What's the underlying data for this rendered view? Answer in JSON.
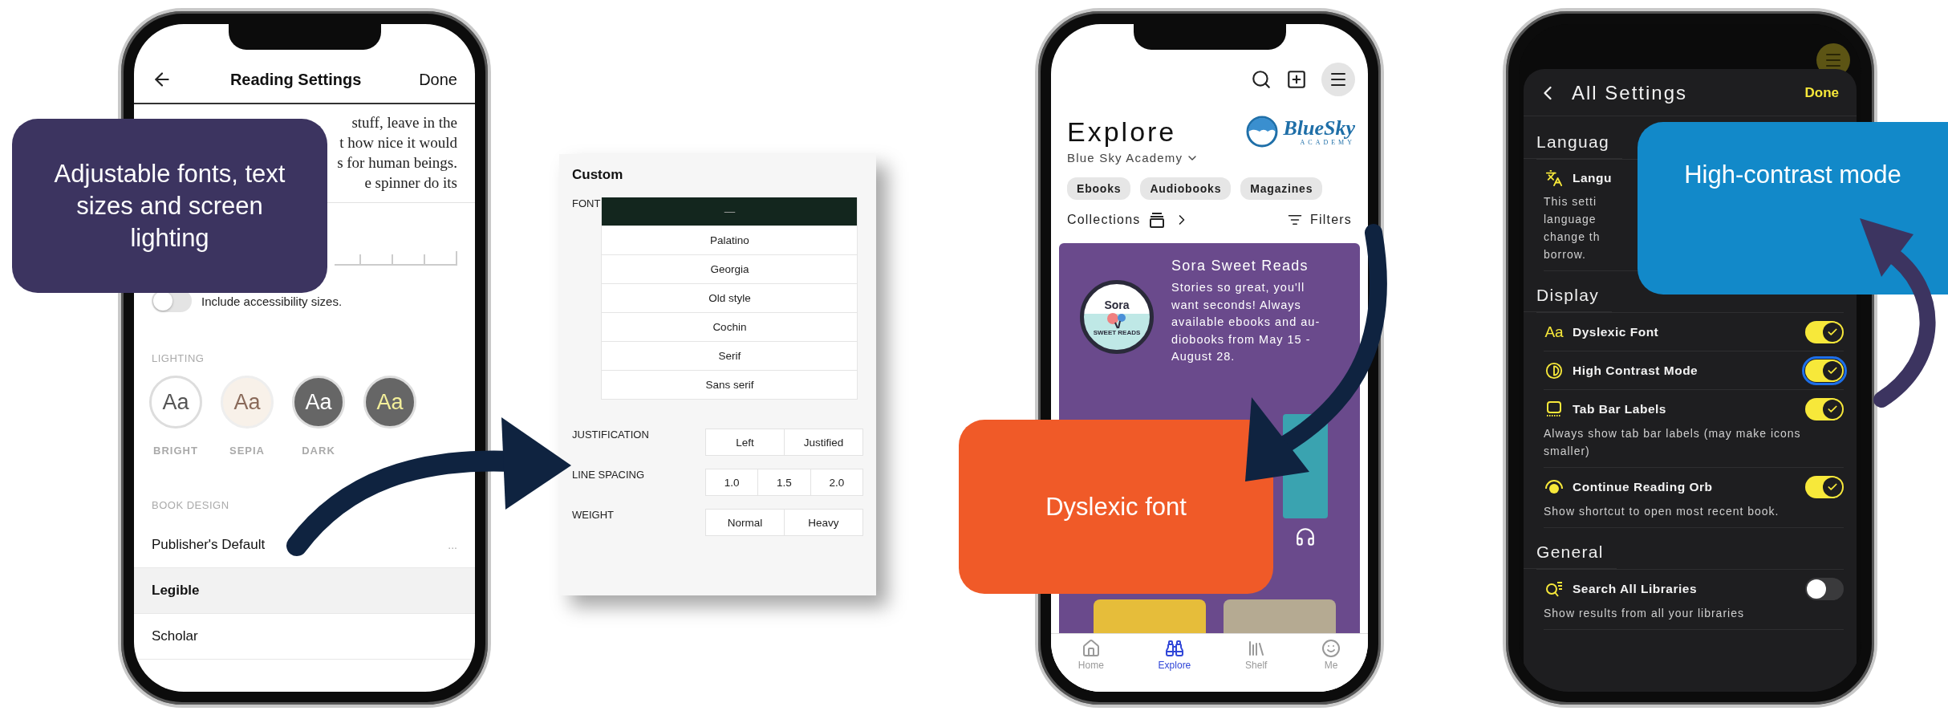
{
  "reading_settings": {
    "title": "Reading Settings",
    "done": "Done",
    "excerpt_lines": [
      "stuff, leave in the",
      "t how nice it would",
      "s for human beings.",
      "e spinner do its"
    ],
    "accessibility_toggle": {
      "label": "Include accessibility sizes.",
      "on": false
    },
    "lighting_label": "LIGHTING",
    "lighting": [
      {
        "kind": "bright",
        "sample": "Aa",
        "label": "BRIGHT"
      },
      {
        "kind": "sepia",
        "sample": "Aa",
        "label": "SEPIA"
      },
      {
        "kind": "dark",
        "sample": "Aa",
        "label": "DARK"
      },
      {
        "kind": "night",
        "sample": "Aa"
      }
    ],
    "book_design_label": "BOOK DESIGN",
    "designs": [
      {
        "label": "Publisher's Default",
        "more": "...",
        "selected": false
      },
      {
        "label": "Legible",
        "selected": true
      },
      {
        "label": "Scholar",
        "selected": false
      }
    ]
  },
  "custom_panel": {
    "title": "Custom",
    "font_label": "FONT",
    "fonts": [
      {
        "label": "—",
        "selected": true
      },
      {
        "label": "Palatino",
        "selected": false
      },
      {
        "label": "Georgia",
        "selected": false
      },
      {
        "label": "Old style",
        "selected": false
      },
      {
        "label": "Cochin",
        "selected": false
      },
      {
        "label": "Serif",
        "selected": false
      },
      {
        "label": "Sans serif",
        "selected": false
      }
    ],
    "rows": [
      {
        "label": "JUSTIFICATION",
        "options": [
          "Left",
          "Justified"
        ]
      },
      {
        "label": "LINE SPACING",
        "options": [
          "1.0",
          "1.5",
          "2.0"
        ]
      },
      {
        "label": "WEIGHT",
        "options": [
          "Normal",
          "Heavy"
        ]
      }
    ]
  },
  "explore": {
    "title": "Explore",
    "logo": {
      "name": "BlueSky",
      "sub": "ACADEMY"
    },
    "library": "Blue Sky Academy",
    "chips": [
      "Ebooks",
      "Audiobooks",
      "Magazines"
    ],
    "collections": "Collections",
    "filters": "Filters",
    "banner": {
      "badge_top": "Sora",
      "badge_bottom": "SWEET READS",
      "title": "Sora Sweet Reads",
      "lines": [
        "Stories so great, you'll",
        "want seconds! Always",
        "available ebooks and au-",
        "diobooks from May 15 -",
        "August 28."
      ]
    },
    "tabs": [
      {
        "label": "Home",
        "selected": false
      },
      {
        "label": "Explore",
        "selected": true
      },
      {
        "label": "Shelf",
        "selected": false
      },
      {
        "label": "Me",
        "selected": false
      }
    ]
  },
  "all_settings": {
    "title": "All Settings",
    "done": "Done",
    "sections": [
      {
        "title": "Languag",
        "items": [
          {
            "kind": "info",
            "title": "Langu",
            "lines": [
              "This setti",
              "language",
              "change th",
              "borrow."
            ]
          }
        ]
      },
      {
        "title": "Display",
        "items": [
          {
            "kind": "toggle",
            "icon_text": "Aa",
            "title": "Dyslexic Font",
            "on": true,
            "focused": false
          },
          {
            "kind": "toggle",
            "title": "High Contrast Mode",
            "on": true,
            "focused": true
          },
          {
            "kind": "toggle",
            "title": "Tab Bar Labels",
            "on": true,
            "focused": false,
            "description": "Always show tab bar labels (may make icons smaller)"
          },
          {
            "kind": "toggle",
            "title": "Continue Reading Orb",
            "on": true,
            "focused": false,
            "description": "Show shortcut to open most recent book."
          }
        ]
      },
      {
        "title": "General",
        "items": [
          {
            "kind": "toggle",
            "title": "Search All Libraries",
            "on": false,
            "focused": false,
            "description": "Show results from all your libraries"
          }
        ]
      }
    ]
  },
  "callouts": [
    {
      "text": "Adjustable fonts, text sizes and screen lighting",
      "color": "#3c3460"
    },
    {
      "text": "Dyslexic font",
      "color": "#f05a28"
    },
    {
      "text": "High-contrast mode",
      "color": "#1289c9"
    }
  ]
}
